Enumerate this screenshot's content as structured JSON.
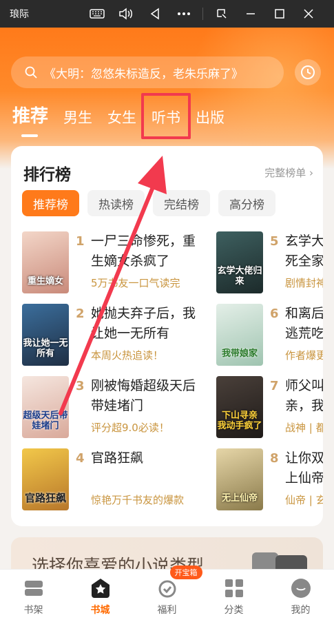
{
  "emulator": {
    "title": "琅际"
  },
  "search": {
    "placeholder": "《大明：忽悠朱标造反，老朱乐麻了》"
  },
  "tabs": [
    {
      "label": "推荐",
      "active": true
    },
    {
      "label": "男生"
    },
    {
      "label": "女生"
    },
    {
      "label": "听书"
    },
    {
      "label": "出版"
    }
  ],
  "ranking": {
    "title": "排行榜",
    "more": "完整榜单 ›",
    "filters": [
      "推荐榜",
      "热读榜",
      "完结榜",
      "高分榜"
    ],
    "books": [
      {
        "rank": "1",
        "title": "一尸三命惨死，重生嫡女杀疯了",
        "desc": "5万书友一口气读完",
        "cover_text": "重生嫡女",
        "cover_color": "#e8b9a8"
      },
      {
        "rank": "2",
        "title": "她抛夫弃子后，我让她一无所有",
        "desc": "本周火热追读！",
        "cover_text": "我让她一无所有",
        "cover_color": "#2d5e8a"
      },
      {
        "rank": "3",
        "title": "刚被悔婚超级天后带娃堵门",
        "desc": "评分超9.0必读！",
        "cover_text": "超级天后带娃堵门",
        "cover_color": "#e9d2c8"
      },
      {
        "rank": "4",
        "title": "官路狂飙",
        "desc": "惊艳万千书友的爆款",
        "cover_text": "官路狂飙",
        "cover_color": "#d8a53a"
      },
      {
        "rank": "5",
        "title": "玄学大佬回来了，死全家",
        "desc": "剧情封神",
        "cover_text": "玄学大佬归来",
        "cover_color": "#2f4a4a"
      },
      {
        "rank": "6",
        "title": "和离后，我带娘家逃荒吃香喝辣",
        "desc": "作者爆更",
        "cover_text": "我带娘家",
        "cover_color": "#cde2d6"
      },
      {
        "rank": "7",
        "title": "师父叫我下山寻亲，我",
        "desc": "战神 | 都市",
        "cover_text": "下山寻亲 我动手疯了",
        "cover_color": "#3a3430"
      },
      {
        "rank": "8",
        "title": "让你双修，你成无上仙帝",
        "desc": "仙帝 | 玄幻",
        "cover_text": "无上仙帝",
        "cover_color": "#c8b27a"
      }
    ]
  },
  "banner": {
    "text": "选择你喜爱的小说类型"
  },
  "nav": [
    {
      "label": "书架",
      "icon": "bookshelf-icon"
    },
    {
      "label": "书城",
      "icon": "star-icon",
      "active": true
    },
    {
      "label": "福利",
      "icon": "gift-icon",
      "badge": "开宝箱"
    },
    {
      "label": "分类",
      "icon": "grid-icon"
    },
    {
      "label": "我的",
      "icon": "avatar-icon"
    }
  ],
  "colors": {
    "accent": "#ff7a1a",
    "highlight": "#f23a4e",
    "desc": "#c9953f"
  }
}
